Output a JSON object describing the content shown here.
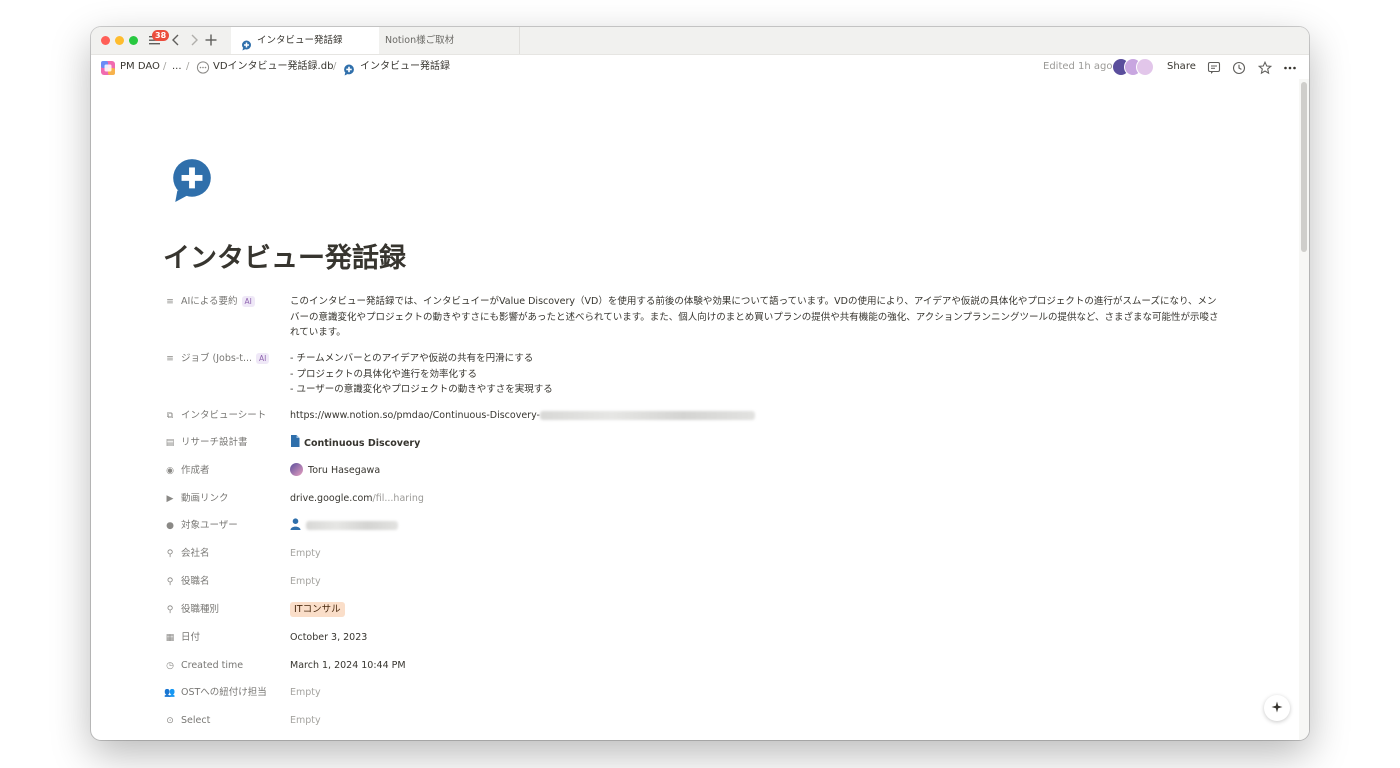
{
  "tabbar": {
    "notification_count": "38",
    "tabs": [
      {
        "label": "インタビュー発話録",
        "active": true
      },
      {
        "label": "Notion様ご取材",
        "active": false
      }
    ],
    "icons": [
      "hamburger-icon",
      "back-arrow-icon",
      "forward-arrow-icon",
      "plus-icon"
    ]
  },
  "breadcrumb": {
    "workspace": "PM DAO",
    "sep1": "/",
    "ellipsis": "...",
    "sep2": "/",
    "database": "VDインタビュー発話録.db",
    "sep3": "/",
    "page": "インタビュー発話録"
  },
  "topbar": {
    "edited": "Edited 1h ago",
    "share": "Share"
  },
  "page": {
    "title": "インタビュー発話録",
    "icon": "speech-bubble-plus-icon"
  },
  "ai_badge": "AI",
  "properties": [
    {
      "name": "AIによる要約",
      "icon": "text-lines-icon",
      "value": "このインタビュー発話録では、インタビュイーがValue Discovery（VD）を使用する前後の体験や効果について語っています。VDの使用により、アイデアや仮説の具体化やプロジェクトの進行がスムーズになり、メンバーの意識変化やプロジェクトの動きやすさにも影響があったと述べられています。また、個人向けのまとめ買いプランの提供や共有機能の強化、アクションプランニングツールの提供など、さまざまな可能性が示唆されています。"
    },
    {
      "name": "ジョブ (Jobs-t...",
      "icon": "text-lines-icon",
      "lines": [
        "- チームメンバーとのアイデアや仮説の共有を円滑にする",
        "- プロジェクトの具体化や進行を効率化する",
        "- ユーザーの意識変化やプロジェクトの動きやすさを実現する"
      ]
    },
    {
      "name": "インタビューシート",
      "icon": "relation-icon",
      "value": "https://www.notion.so/pmdao/Continuous-Discovery-"
    },
    {
      "name": "リサーチ設計書",
      "icon": "document-icon",
      "value": "Continuous Discovery"
    },
    {
      "name": "作成者",
      "icon": "person-circle-icon",
      "value": "Toru Hasegawa"
    },
    {
      "name": "動画リンク",
      "icon": "video-icon",
      "value": "drive.google.com",
      "suffix": "/fil...haring"
    },
    {
      "name": "対象ユーザー",
      "icon": "person-icon"
    },
    {
      "name": "会社名",
      "icon": "search-icon",
      "value": "Empty"
    },
    {
      "name": "役職名",
      "icon": "search-icon",
      "value": "Empty"
    },
    {
      "name": "役職種別",
      "icon": "search-icon",
      "value": "ITコンサル"
    },
    {
      "name": "日付",
      "icon": "calendar-icon",
      "value": "October 3, 2023"
    },
    {
      "name": "Created time",
      "icon": "clock-icon",
      "value": "March 1, 2024 10:44 PM"
    },
    {
      "name": "OSTへの紐付け担当",
      "icon": "people-icon",
      "value": "Empty"
    },
    {
      "name": "Select",
      "icon": "select-circle-icon",
      "value": "Empty"
    }
  ],
  "colors": {
    "accent_blue": "#2f6fab",
    "tag_bg": "#fadec9",
    "traffic_red": "#ff5f57",
    "traffic_yellow": "#febc2e",
    "traffic_green": "#28c840"
  }
}
